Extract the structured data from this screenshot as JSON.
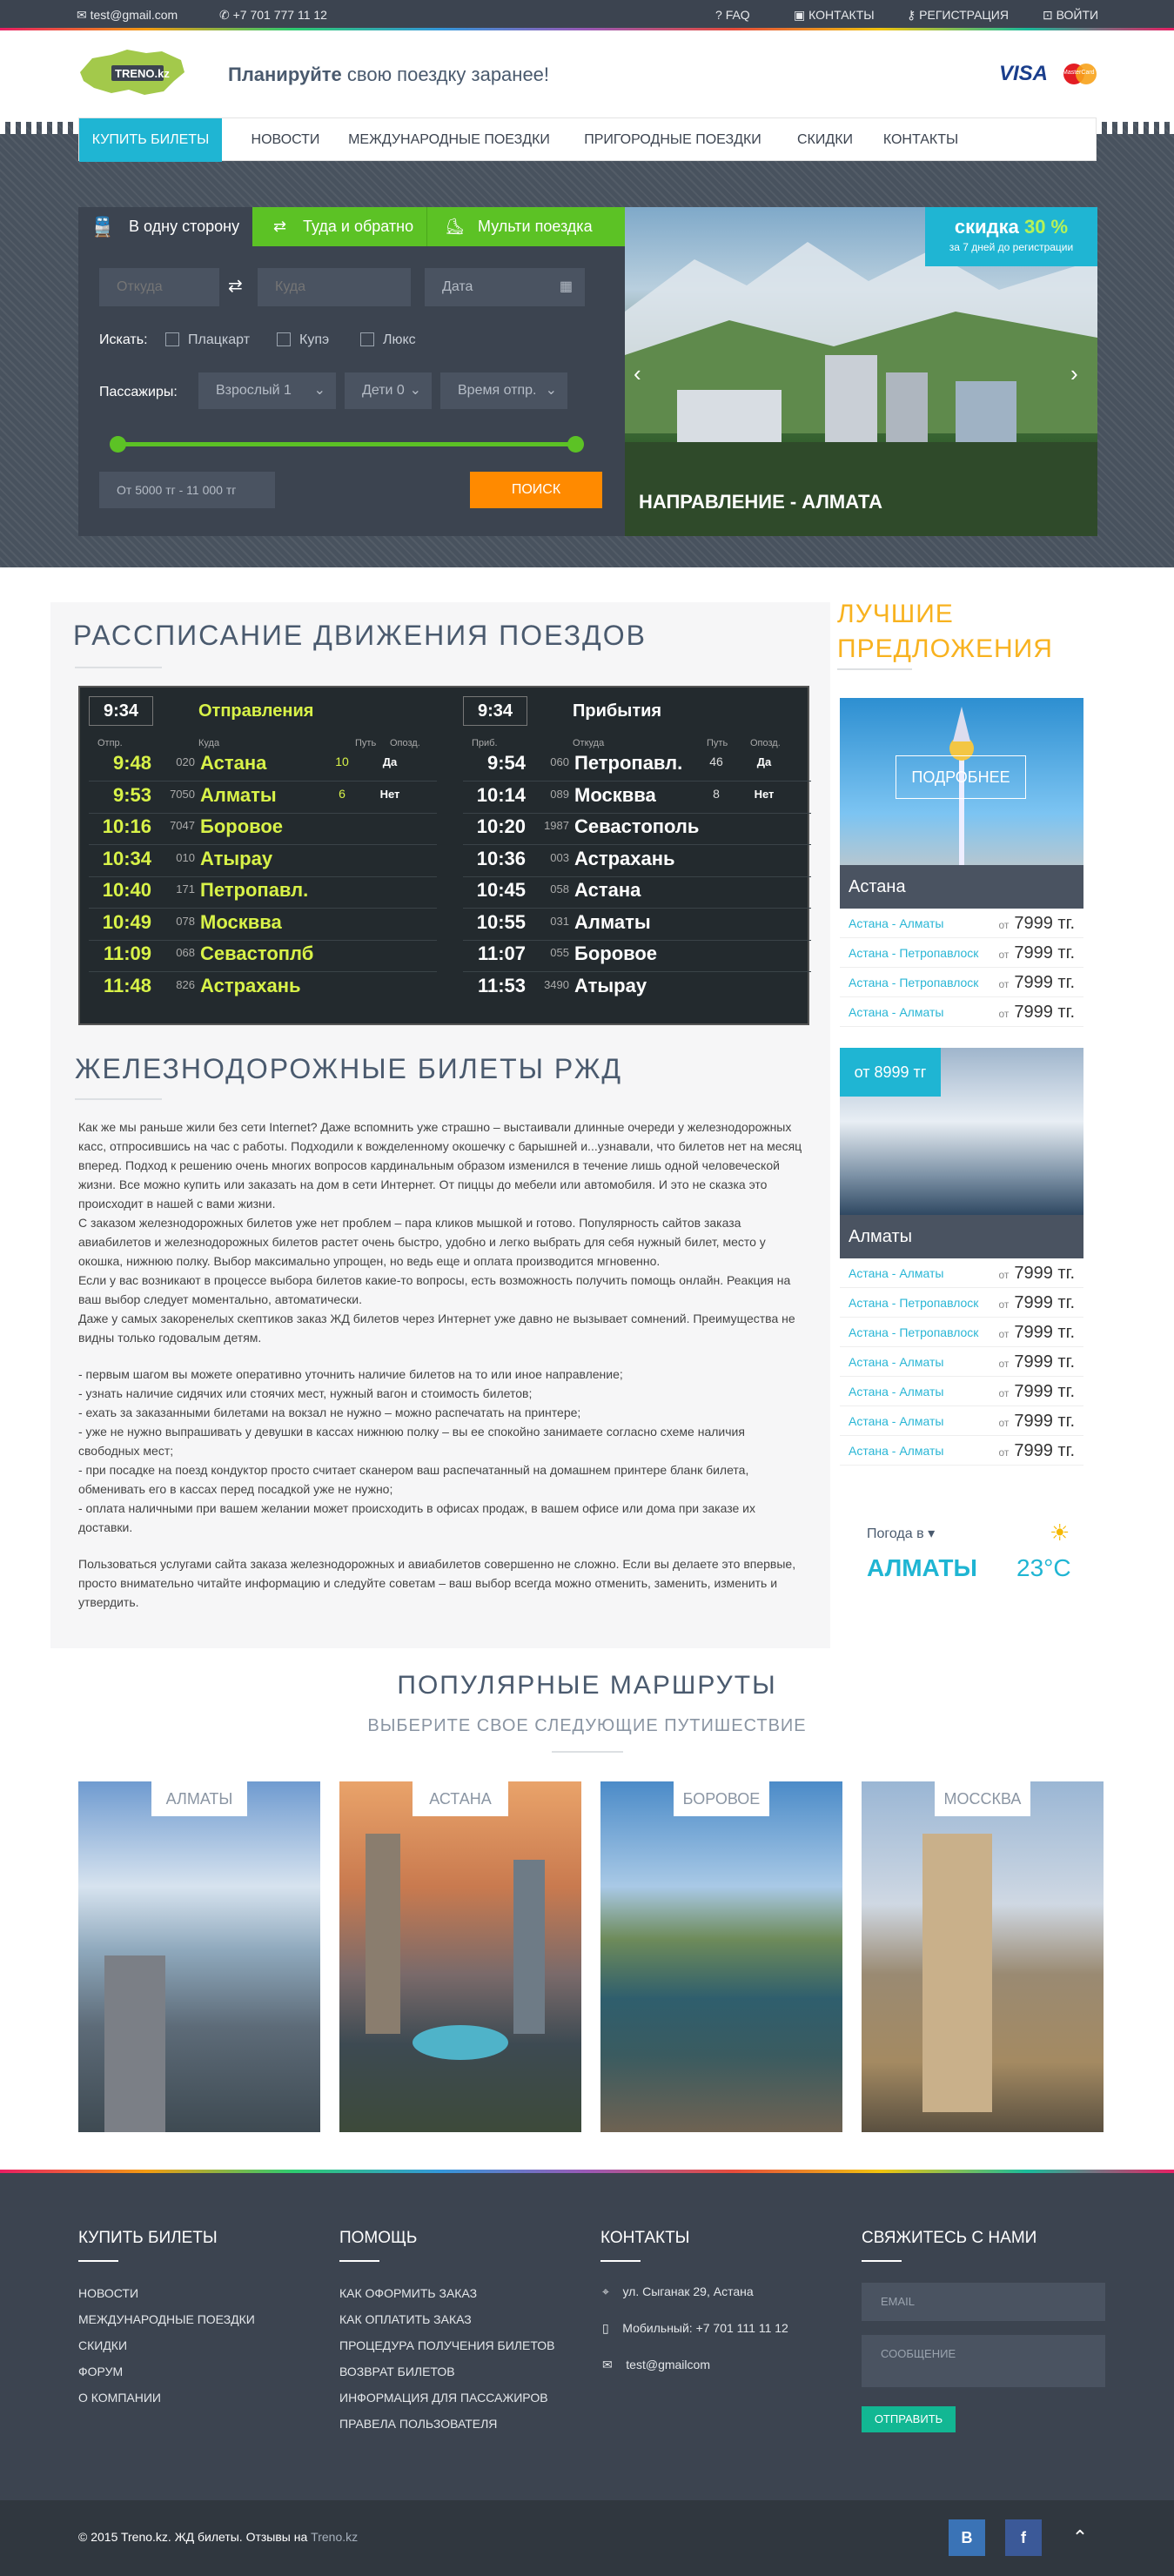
{
  "topbar": {
    "email": "test@gmail.com",
    "phone": "+7 701 777 11 12",
    "faq": "FAQ",
    "contacts": "КОНТАКТЫ",
    "register": "РЕГИСТРАЦИЯ",
    "login": "ВОЙТИ"
  },
  "header": {
    "logo": "TRENO.kz",
    "slogan_bold": "Планируйте",
    "slogan_rest": "свою поездку заранее!",
    "visa": "VISA",
    "mastercard": "MasterCard"
  },
  "nav": {
    "items": [
      "КУПИТЬ БИЛЕТЫ",
      "НОВОСТИ",
      "МЕЖДУНАРОДНЫЕ ПОЕЗДКИ",
      "ПРИГОРОДНЫЕ ПОЕЗДКИ",
      "СКИДКИ",
      "КОНТАКТЫ"
    ]
  },
  "search": {
    "tabs": [
      "В одну сторону",
      "Туда и обратно",
      "Мульти поездка"
    ],
    "from_placeholder": "Откуда",
    "to_placeholder": "Куда",
    "date_placeholder": "Дата",
    "find_label": "Искать:",
    "classes": [
      "Плацкарт",
      "Купэ",
      "Люкс"
    ],
    "passengers_label": "Пассажиры:",
    "adults": "Взрослый 1",
    "children": "Дети 0",
    "time": "Время отпр.",
    "price_range": "От 5000 тг - 11 000 тг",
    "search_button": "ПОИСК",
    "colors": {
      "green": "#5cc225",
      "orange": "#ff8a00",
      "cyan": "#1fb5d3"
    }
  },
  "promo": {
    "discount_word": "скидка",
    "discount_value": "30 %",
    "discount_note": "за 7 дней до регистрации",
    "destination": "НАПРАВЛЕНИЕ - АЛМАТА"
  },
  "schedule": {
    "title": "РАССПИСАНИЕ ДВИЖЕНИЯ ПОЕЗДОВ",
    "dep": {
      "clock": "9:34",
      "title": "Отправления",
      "cols": [
        "Отпр.",
        "Куда",
        "Путь",
        "Опозд."
      ],
      "rows": [
        [
          "9:48",
          "020",
          "Астана",
          "10",
          "Да"
        ],
        [
          "9:53",
          "7050",
          "Алматы",
          "6",
          "Нет"
        ],
        [
          "10:16",
          "7047",
          "Боровое",
          "",
          ""
        ],
        [
          "10:34",
          "010",
          "Атырау",
          "",
          ""
        ],
        [
          "10:40",
          "171",
          "Петропавл.",
          "",
          ""
        ],
        [
          "10:49",
          "078",
          "Москвва",
          "",
          ""
        ],
        [
          "11:09",
          "068",
          "Севастоплб",
          "",
          ""
        ],
        [
          "11:48",
          "826",
          "Астрахань",
          "",
          ""
        ]
      ]
    },
    "arr": {
      "clock": "9:34",
      "title": "Прибытия",
      "cols": [
        "Приб.",
        "Откуда",
        "Путь",
        "Опозд."
      ],
      "rows": [
        [
          "9:54",
          "060",
          "Петропавл.",
          "46",
          "Да"
        ],
        [
          "10:14",
          "089",
          "Москвва",
          "8",
          "Нет"
        ],
        [
          "10:20",
          "1987",
          "Севастополь",
          "",
          ""
        ],
        [
          "10:36",
          "003",
          "Астрахань",
          "",
          ""
        ],
        [
          "10:45",
          "058",
          "Астана",
          "",
          ""
        ],
        [
          "10:55",
          "031",
          "Алматы",
          "",
          ""
        ],
        [
          "11:07",
          "055",
          "Боровое",
          "",
          ""
        ],
        [
          "11:53",
          "3490",
          "Атырау",
          "",
          ""
        ]
      ]
    }
  },
  "article": {
    "title": "ЖЕЛЕЗНОДОРОЖНЫЕ БИЛЕТЫ РЖД",
    "p1": "Как же мы раньше жили без сети Internet? Даже вспомнить уже страшно – выстаивали длинные очереди у железнодорожных касс, отпросившись на час с работы. Подходили к вожделенному окошечку с барышней и...узнавали, что билетов нет на месяц вперед. Подход к решению очень многих вопросов кардинальным образом изменился в течение лишь одной человеческой жизни. Все можно купить или заказать на дом в сети Интернет. От пиццы до мебели или автомобиля. И это не сказка это происходит в нашей с вами жизни.",
    "p2": "С заказом железнодорожных билетов уже нет проблем – пара кликов мышкой и готово. Популярность сайтов заказа авиабилетов и железнодорожных билетов растет очень быстро, удобно и легко выбрать для себя нужный билет, место у окошка, нижнюю полку. Выбор максимально упрощен, но ведь еще и оплата производится мгновенно.",
    "p3": "Если у вас возникают в процессе выбора билетов какие-то вопросы, есть возможность получить помощь онлайн. Реакция на ваш выбор следует моментально, автоматически.",
    "p4": "Даже у самых закоренелых скептиков заказ ЖД билетов через Интернет уже давно не вызывает сомнений. Преимущества не видны только годовалым детям.",
    "bullets": [
      "- первым шагом вы можете оперативно уточнить наличие билетов на то или иное направление;",
      "- узнать наличие сидячих или стоячих мест, нужный вагон и стоимость билетов;",
      "- ехать за заказанными билетами на вокзал не нужно – можно распечатать на принтере;",
      "- уже не нужно выпрашивать у девушки в кассах нижнюю полку – вы ее спокойно занимаете согласно схеме наличия свободных мест;",
      "- при посадке на поезд кондуктор просто считает сканером ваш распечатанный на домашнем принтере бланк билета, обменивать его в кассах перед посадкой уже не нужно;",
      "- оплата наличными при вашем желании может происходить в офисах продаж, в вашем офисе или дома при заказе их доставки."
    ],
    "p5": "Пользоваться услугами сайта заказа железнодорожных и авиабилетов совершенно не сложно. Если вы делаете это впервые, просто внимательно читайте информацию и следуйте советам – ваш выбор всегда можно отменить, заменить, изменить и утвердить."
  },
  "offers": {
    "title": "ЛУЧШИЕ ПРЕДЛОЖЕНИЯ",
    "card1": {
      "city": "Астана",
      "more": "ПОДРОБНЕЕ",
      "rows": [
        [
          "Астана - Алматы",
          "от",
          "7999 тг."
        ],
        [
          "Астана - Петропавлоск",
          "от",
          "7999 тг."
        ],
        [
          "Астана - Петропавлоск",
          "от",
          "7999 тг."
        ],
        [
          "Астана - Алматы",
          "от",
          "7999 тг."
        ]
      ]
    },
    "card2": {
      "city": "Алматы",
      "badge": "от 8999 тг",
      "rows": [
        [
          "Астана - Алматы",
          "от",
          "7999 тг."
        ],
        [
          "Астана - Петропавлоск",
          "от",
          "7999 тг."
        ],
        [
          "Астана - Петропавлоск",
          "от",
          "7999 тг."
        ],
        [
          "Астана - Алматы",
          "от",
          "7999 тг."
        ],
        [
          "Астана - Алматы",
          "от",
          "7999 тг."
        ],
        [
          "Астана - Алматы",
          "от",
          "7999 тг."
        ],
        [
          "Астана - Алматы",
          "от",
          "7999 тг."
        ]
      ]
    },
    "weather": {
      "label": "Погода в",
      "city": "АЛМАТЫ",
      "temp": "23°C"
    }
  },
  "routes": {
    "title": "ПОПУЛЯРНЫЕ МАРШРУТЫ",
    "subtitle": "ВЫБЕРИТЕ СВОЕ СЛЕДУЮЩИЕ ПУТИШЕСТВИЕ",
    "items": [
      "АЛМАТЫ",
      "АСТАНА",
      "БОРОВОЕ",
      "МОССКВА"
    ]
  },
  "footer": {
    "col1": {
      "title": "КУПИТЬ БИЛЕТЫ",
      "links": [
        "НОВОСТИ",
        "МЕЖДУНАРОДНЫЕ ПОЕЗДКИ",
        "СКИДКИ",
        "ФОРУМ",
        "О КОМПАНИИ"
      ]
    },
    "col2": {
      "title": "ПОМОЩЬ",
      "links": [
        "КАК ОФОРМИТЬ ЗАКАЗ",
        "КАК ОПЛАТИТЬ ЗАКАЗ",
        "ПРОЦЕДУРА ПОЛУЧЕНИЯ БИЛЕТОВ",
        "ВОЗВРАТ БИЛЕТОВ",
        "ИНФОРМАЦИЯ ДЛЯ ПАССАЖИРОВ",
        "ПРАВЕЛА ПОЛЬЗОВАТЕЛЯ"
      ]
    },
    "col3": {
      "title": "КОНТАКТЫ",
      "address": "ул. Сыганак 29, Астана",
      "mobile": "Мобильный: +7 701 111 11 12",
      "email": "test@gmailcom"
    },
    "col4": {
      "title": "СВЯЖИТЕСЬ С НАМИ",
      "email_placeholder": "EMAIL",
      "message_placeholder": "СООБЩЕНИЕ",
      "send": "ОТПРАВИТЬ"
    },
    "copyright": "© 2015 Treno.kz. ЖД билеты. Отзывы на",
    "copyright_link": "Treno.kz",
    "social": [
      "В",
      "f"
    ]
  }
}
